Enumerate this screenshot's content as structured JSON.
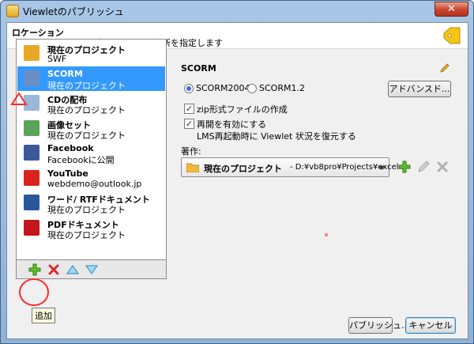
{
  "window": {
    "title": "Viewletのパブリッシュ",
    "close_label": "✕"
  },
  "header": {
    "title": "ロケーション",
    "subtitle": "ビューレットをパブリッシュする場所を指定します"
  },
  "locations": [
    {
      "name": "現在のプロジェクト",
      "sub": "SWF",
      "icon": "folder-icon",
      "color": "#e8a826"
    },
    {
      "name": "SCORM",
      "sub": "現在のプロジェクト",
      "icon": "scorm-icon",
      "color": "#6a8fc4",
      "selected": true
    },
    {
      "name": "CDの配布",
      "sub": "現在のプロジェクト",
      "icon": "cd-icon",
      "color": "#9ab8d8"
    },
    {
      "name": "画像セット",
      "sub": "現在のプロジェクト",
      "icon": "image-icon",
      "color": "#5aa35a"
    },
    {
      "name": "Facebook",
      "sub": "Facebookに公開",
      "icon": "facebook-icon",
      "color": "#3b5998"
    },
    {
      "name": "YouTube",
      "sub": "webdemo@outlook.jp",
      "icon": "youtube-icon",
      "color": "#d8231f"
    },
    {
      "name": "ワード/ RTFドキュメント",
      "sub": "現在のプロジェクト",
      "icon": "word-icon",
      "color": "#2b579a"
    },
    {
      "name": "PDFドキュメント",
      "sub": "現在のプロジェクト",
      "icon": "pdf-icon",
      "color": "#c4161c"
    }
  ],
  "toolbar": {
    "tooltip": "追加"
  },
  "scorm": {
    "title": "SCORM",
    "radio1": "SCORM2004",
    "radio2": "SCORM1.2",
    "advanced_label": "アドバンスド...",
    "zip_label": "zip形式ファイルの作成",
    "resume_label": "再開を有効にする",
    "resume_note": "LMS再起動時に Viewlet 状況を復元する",
    "author_label": "著作:",
    "author_value": "現在のプロジェクト",
    "author_path": "- D:¥vb8pro¥Projects¥excel..."
  },
  "footer": {
    "publish_label": "パブリッシュ...",
    "cancel_label": "キャンセル"
  },
  "colors": {
    "selection": "#3399ff",
    "annotation": "#ff2a2a"
  }
}
